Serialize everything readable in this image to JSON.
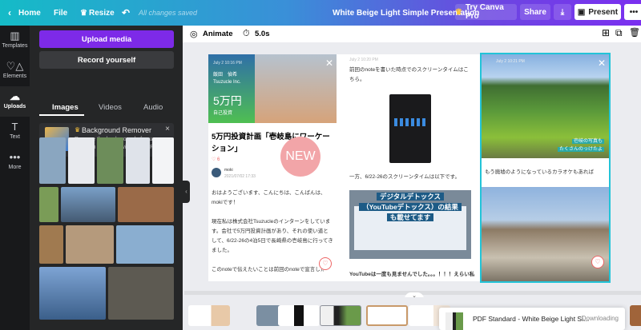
{
  "topbar": {
    "home": "Home",
    "file": "File",
    "resize": "Resize",
    "status": "All changes saved",
    "title": "White Beige Light Simple Presentation",
    "try_pro": "Try Canva Pro",
    "share": "Share",
    "present": "Present"
  },
  "rail": [
    {
      "label": "Templates",
      "icon": "templates-icon"
    },
    {
      "label": "Elements",
      "icon": "elements-icon"
    },
    {
      "label": "Uploads",
      "icon": "upload-icon"
    },
    {
      "label": "Text",
      "icon": "text-icon"
    },
    {
      "label": "More",
      "icon": "more-icon"
    }
  ],
  "panel": {
    "upload": "Upload media",
    "record": "Record yourself",
    "tabs": [
      "Images",
      "Videos",
      "Audio"
    ],
    "promo_title": "Background Remover",
    "promo_text": "Remove the background of your image in one click with Canva Pro."
  },
  "toolbar": {
    "animate": "Animate",
    "duration": "5.0s"
  },
  "slide": {
    "col1": {
      "date": "July 2  10:16 PM",
      "name": "飯田　偵希",
      "company": "Tsuzucle Inc.",
      "amount": "5万円",
      "sub": "自己投資",
      "title": "5万円投資計画「壱岐島にワーケーション」",
      "likes": "6",
      "author": "moki",
      "timestamp": "2021/07/02 17:33",
      "badge": "NEW",
      "p1": "おはようございます、こんにちは、こんばんは、mokiです！",
      "p2": "現在私は株式会社Tsuzucleのインターンをしています。会社で5万円投資計画があり、それの使い道として、6/22-26の4泊5日で長崎県の壱岐島に行ってきました。",
      "p3": "このnoteで伝えたいことは前回のnoteで宣言した"
    },
    "col2": {
      "date": "July 2  10:20 PM",
      "p1": "前回のnoteを書いた時点でのスクリーンタイムはこちら。",
      "p2": "一方、6/22-26のスクリーンタイムは以下です。",
      "banner": [
        "デジタルデトックス",
        "（YouTubeデトックス）の結果",
        "も載せてます"
      ],
      "p3": "YouTubeは一度も見ませんでした。。。！！！えらい私"
    },
    "col3": {
      "date": "July 2  10:21 PM",
      "caption": [
        "壱岐の写真も",
        "たくさんのっけたよ"
      ],
      "p1": "もう廃墟のようになっているカラオケもあれば"
    }
  },
  "download": {
    "format": "PDF Standard",
    "title": "White Beige Light Si...",
    "status": "Downloading"
  }
}
